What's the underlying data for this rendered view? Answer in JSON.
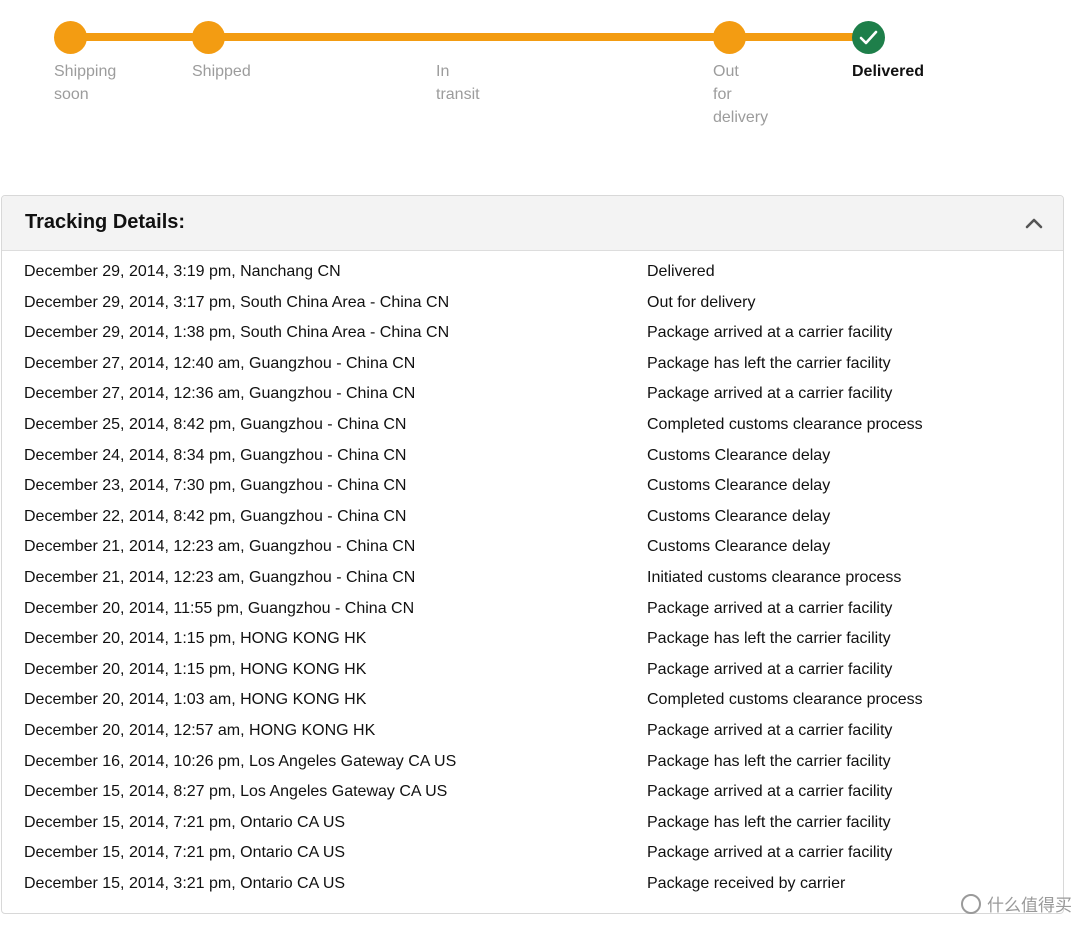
{
  "tracker": {
    "steps": [
      {
        "label_line1": "Shipping",
        "label_line2": "soon",
        "label_line3": "",
        "state": "passed"
      },
      {
        "label_line1": "Shipped",
        "label_line2": "",
        "label_line3": "",
        "state": "passed"
      },
      {
        "label_line1": "In",
        "label_line2": "transit",
        "label_line3": "",
        "state": "passed"
      },
      {
        "label_line1": "Out",
        "label_line2": "for",
        "label_line3": "delivery",
        "state": "passed"
      },
      {
        "label_line1": "Delivered",
        "label_line2": "",
        "label_line3": "",
        "state": "current"
      }
    ],
    "accent_color": "#f39c12",
    "done_color": "#1e7f4a",
    "done_icon": "checkmark-icon"
  },
  "tracking_panel": {
    "title": "Tracking Details:",
    "toggle_icon": "chevron-up-icon",
    "events": [
      {
        "when": "December 29, 2014, 3:19 pm, Nanchang CN",
        "status": "Delivered"
      },
      {
        "when": "December 29, 2014, 3:17 pm, South China Area - China CN",
        "status": "Out for delivery"
      },
      {
        "when": "December 29, 2014, 1:38 pm, South China Area - China CN",
        "status": "Package arrived at a carrier facility"
      },
      {
        "when": "December 27, 2014, 12:40 am, Guangzhou - China CN",
        "status": "Package has left the carrier facility"
      },
      {
        "when": "December 27, 2014, 12:36 am, Guangzhou - China CN",
        "status": "Package arrived at a carrier facility"
      },
      {
        "when": "December 25, 2014, 8:42 pm, Guangzhou - China CN",
        "status": "Completed customs clearance process"
      },
      {
        "when": "December 24, 2014, 8:34 pm, Guangzhou - China CN",
        "status": "Customs Clearance delay"
      },
      {
        "when": "December 23, 2014, 7:30 pm, Guangzhou - China CN",
        "status": "Customs Clearance delay"
      },
      {
        "when": "December 22, 2014, 8:42 pm, Guangzhou - China CN",
        "status": "Customs Clearance delay"
      },
      {
        "when": "December 21, 2014, 12:23 am, Guangzhou - China CN",
        "status": "Customs Clearance delay"
      },
      {
        "when": "December 21, 2014, 12:23 am, Guangzhou - China CN",
        "status": "Initiated customs clearance process"
      },
      {
        "when": "December 20, 2014, 11:55 pm, Guangzhou - China CN",
        "status": "Package arrived at a carrier facility"
      },
      {
        "when": "December 20, 2014, 1:15 pm, HONG KONG HK",
        "status": "Package has left the carrier facility"
      },
      {
        "when": "December 20, 2014, 1:15 pm, HONG KONG HK",
        "status": "Package arrived at a carrier facility"
      },
      {
        "when": "December 20, 2014, 1:03 am, HONG KONG HK",
        "status": "Completed customs clearance process"
      },
      {
        "when": "December 20, 2014, 12:57 am, HONG KONG HK",
        "status": "Package arrived at a carrier facility"
      },
      {
        "when": "December 16, 2014, 10:26 pm, Los Angeles Gateway CA US",
        "status": "Package has left the carrier facility"
      },
      {
        "when": "December 15, 2014, 8:27 pm, Los Angeles Gateway CA US",
        "status": "Package arrived at a carrier facility"
      },
      {
        "when": "December 15, 2014, 7:21 pm, Ontario CA US",
        "status": "Package has left the carrier facility"
      },
      {
        "when": "December 15, 2014, 7:21 pm, Ontario CA US",
        "status": "Package arrived at a carrier facility"
      },
      {
        "when": "December 15, 2014, 3:21 pm, Ontario CA US",
        "status": "Package received by carrier"
      }
    ]
  },
  "watermark": {
    "text": "什么值得买",
    "icon": "smzdm-logo-icon"
  }
}
